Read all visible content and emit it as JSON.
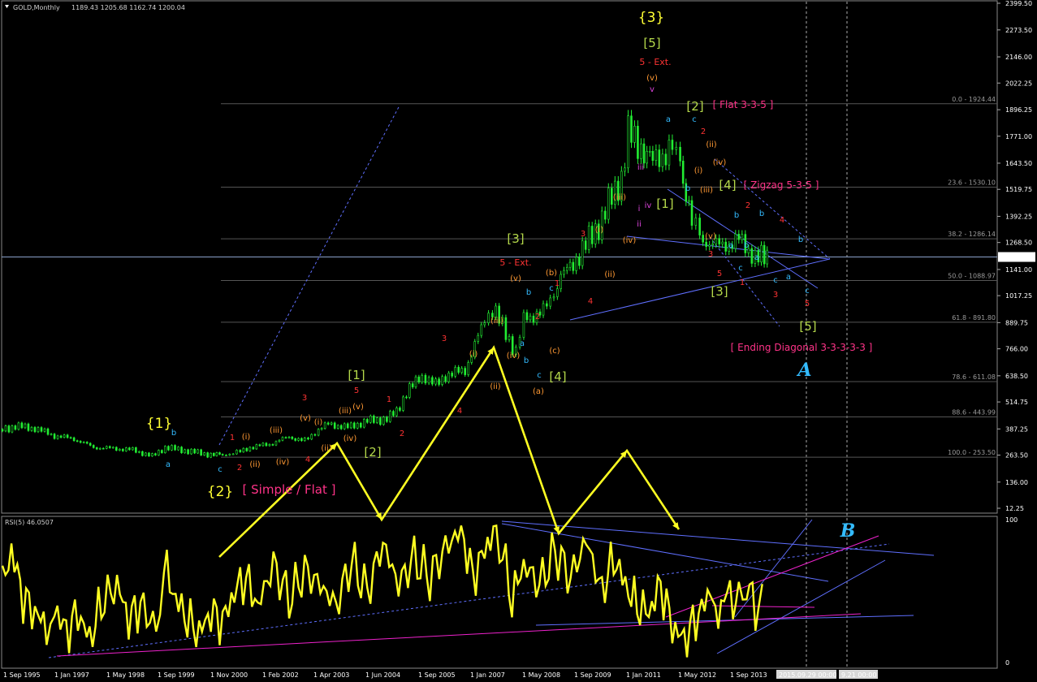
{
  "colors": {
    "background": "#000000",
    "price_candles": "#22ee33",
    "rsi_line": "#ffff22",
    "grid": "#2a2a2a",
    "fib_lines": "#555555",
    "trend_lines": "#5f6fff",
    "zigzag": "#ffff22",
    "magenta_lines": "#ee22cc",
    "wave_yellow": "#ffff33",
    "wave_green": "#b4d84a",
    "wave_red": "#ff3333",
    "wave_orange": "#ff9933",
    "wave_cyan": "#33bbff",
    "wave_violet": "#dd44dd",
    "label_pink": "#ff3388",
    "current_price_bg": "#000000"
  },
  "header": {
    "symbol_label": "GOLD,Monthly",
    "ohlc": "1189.43 1205.68 1162.74 1200.04"
  },
  "rsi_header": "RSI(5) 46.0507",
  "current_price": "1200.04",
  "chart_data": {
    "type": "candlestick",
    "series": [
      {
        "name": "GOLD,Monthly",
        "pane": "price"
      },
      {
        "name": "RSI(5)",
        "pane": "indicator"
      }
    ],
    "price_axis_ticks": [
      "2399.50",
      "2273.50",
      "2146.00",
      "2022.25",
      "1896.25",
      "1771.00",
      "1643.50",
      "1519.75",
      "1392.25",
      "1268.50",
      "1141.00",
      "1017.25",
      "889.75",
      "766.00",
      "638.50",
      "514.75",
      "387.25",
      "263.50",
      "136.00",
      "12.25"
    ],
    "rsi_axis_ticks": [
      "100",
      "0"
    ],
    "date_ticks": [
      "1 Sep 1995",
      "1 Jan 1997",
      "1 May 1998",
      "1 Sep 1999",
      "1 Nov 2000",
      "1 Feb 2002",
      "1 Apr 2003",
      "1 Jun 2004",
      "1 Sep 2005",
      "1 Jan 2007",
      "1 May 2008",
      "1 Sep 2009",
      "1 Jan 2011",
      "1 May 2012",
      "1 Sep 2013",
      "2015.09.29 00:00",
      "9.21 00:00"
    ],
    "fib_levels": [
      {
        "label": "0.0 - 1924.44",
        "value": 1924.44
      },
      {
        "label": "23.6 - 1530.10",
        "value": 1530.1
      },
      {
        "label": "38.2 - 1286.14",
        "value": 1286.14
      },
      {
        "label": "50.0 - 1088.97",
        "value": 1088.97
      },
      {
        "label": "61.8 - 891.80",
        "value": 891.8
      },
      {
        "label": "78.6 - 611.08",
        "value": 611.08
      },
      {
        "label": "88.6 - 443.99",
        "value": 443.99
      },
      {
        "label": "100.0 - 253.50",
        "value": 253.5
      }
    ],
    "price_series": [
      [
        1995.67,
        385
      ],
      [
        1996.0,
        400
      ],
      [
        1996.5,
        390
      ],
      [
        1997.0,
        355
      ],
      [
        1997.5,
        340
      ],
      [
        1998.0,
        300
      ],
      [
        1998.5,
        295
      ],
      [
        1999.0,
        288
      ],
      [
        1999.5,
        258
      ],
      [
        1999.83,
        300
      ],
      [
        2000.0,
        295
      ],
      [
        2000.5,
        280
      ],
      [
        2001.0,
        265
      ],
      [
        2001.3,
        265
      ],
      [
        2001.75,
        280
      ],
      [
        2002.0,
        300
      ],
      [
        2002.5,
        315
      ],
      [
        2003.0,
        350
      ],
      [
        2003.4,
        330
      ],
      [
        2003.75,
        385
      ],
      [
        2004.0,
        410
      ],
      [
        2004.5,
        395
      ],
      [
        2005.0,
        425
      ],
      [
        2005.5,
        435
      ],
      [
        2005.75,
        470
      ],
      [
        2006.0,
        560
      ],
      [
        2006.4,
        640
      ],
      [
        2006.75,
        595
      ],
      [
        2007.0,
        640
      ],
      [
        2007.5,
        665
      ],
      [
        2008.0,
        900
      ],
      [
        2008.2,
        960
      ],
      [
        2008.8,
        750
      ],
      [
        2009.0,
        910
      ],
      [
        2009.5,
        940
      ],
      [
        2009.95,
        1100
      ],
      [
        2010.5,
        1230
      ],
      [
        2011.0,
        1380
      ],
      [
        2011.5,
        1580
      ],
      [
        2011.67,
        1780
      ],
      [
        2012.0,
        1720
      ],
      [
        2012.3,
        1650
      ],
      [
        2012.8,
        1720
      ],
      [
        2013.0,
        1640
      ],
      [
        2013.3,
        1380
      ],
      [
        2013.5,
        1290
      ],
      [
        2014.0,
        1250
      ],
      [
        2014.5,
        1280
      ],
      [
        2015.0,
        1190
      ],
      [
        2015.3,
        1200
      ]
    ],
    "rsi_series": [
      [
        1995.67,
        55
      ],
      [
        1995.9,
        80
      ],
      [
        1996.2,
        45
      ],
      [
        1996.5,
        35
      ],
      [
        1996.8,
        25
      ],
      [
        1997.0,
        40
      ],
      [
        1997.3,
        20
      ],
      [
        1997.6,
        35
      ],
      [
        1997.9,
        15
      ],
      [
        1998.2,
        42
      ],
      [
        1998.6,
        55
      ],
      [
        1998.9,
        30
      ],
      [
        1999.2,
        40
      ],
      [
        1999.6,
        25
      ],
      [
        1999.8,
        70
      ],
      [
        2000.1,
        45
      ],
      [
        2000.4,
        30
      ],
      [
        2000.7,
        20
      ],
      [
        2001.0,
        35
      ],
      [
        2001.3,
        28
      ],
      [
        2001.6,
        50
      ],
      [
        2001.9,
        60
      ],
      [
        2002.2,
        40
      ],
      [
        2002.6,
        70
      ],
      [
        2003.0,
        45
      ],
      [
        2003.4,
        65
      ],
      [
        2003.8,
        55
      ],
      [
        2004.2,
        40
      ],
      [
        2004.6,
        72
      ],
      [
        2005.0,
        50
      ],
      [
        2005.4,
        85
      ],
      [
        2005.8,
        55
      ],
      [
        2006.2,
        75
      ],
      [
        2006.6,
        60
      ],
      [
        2007.0,
        82
      ],
      [
        2007.4,
        95
      ],
      [
        2007.7,
        60
      ],
      [
        2008.0,
        80
      ],
      [
        2008.3,
        98
      ],
      [
        2008.7,
        45
      ],
      [
        2009.0,
        70
      ],
      [
        2009.4,
        55
      ],
      [
        2009.8,
        80
      ],
      [
        2010.2,
        60
      ],
      [
        2010.6,
        88
      ],
      [
        2011.0,
        50
      ],
      [
        2011.3,
        75
      ],
      [
        2011.6,
        55
      ],
      [
        2011.9,
        40
      ],
      [
        2012.2,
        35
      ],
      [
        2012.5,
        55
      ],
      [
        2012.8,
        25
      ],
      [
        2013.1,
        15
      ],
      [
        2013.4,
        30
      ],
      [
        2013.7,
        45
      ],
      [
        2013.9,
        30
      ],
      [
        2014.2,
        50
      ],
      [
        2014.5,
        40
      ],
      [
        2014.7,
        55
      ],
      [
        2015.0,
        35
      ],
      [
        2015.2,
        40
      ]
    ],
    "ylim_price": [
      12.25,
      2399.5
    ],
    "ylim_rsi": [
      0,
      100
    ],
    "grid": true,
    "wave_labels": [
      {
        "text": "{1}",
        "color": "wave_yellow"
      },
      {
        "text": "{2}",
        "color": "wave_yellow"
      },
      {
        "text": "[ Simple / Flat ]",
        "color": "label_pink"
      },
      {
        "text": "[1]",
        "color": "wave_green"
      },
      {
        "text": "[2]",
        "color": "wave_green"
      },
      {
        "text": "[3]",
        "color": "wave_green"
      },
      {
        "text": "5 - Ext.",
        "color": "wave_red"
      },
      {
        "text": "[4]",
        "color": "wave_green"
      },
      {
        "text": "{3}",
        "color": "wave_yellow"
      },
      {
        "text": "[5]",
        "color": "wave_green"
      },
      {
        "text": "5 - Ext.",
        "color": "wave_red"
      },
      {
        "text": "[2]",
        "color": "wave_green"
      },
      {
        "text": "[ Flat 3-3-5 ]",
        "color": "label_pink"
      },
      {
        "text": "[4]",
        "color": "wave_green"
      },
      {
        "text": "[ Zigzag 5-3-5 ]",
        "color": "label_pink"
      },
      {
        "text": "[1]",
        "color": "wave_green"
      },
      {
        "text": "[3]",
        "color": "wave_green"
      },
      {
        "text": "[5]",
        "color": "wave_green"
      },
      {
        "text": "[ Ending Diagonal 3-3-3-3-3 ]",
        "color": "label_pink"
      },
      {
        "text": "A",
        "color": "wave_cyan"
      },
      {
        "text": "B",
        "color": "wave_cyan"
      }
    ],
    "small_labels": [
      {
        "text": "a",
        "color": "wave_cyan"
      },
      {
        "text": "b",
        "color": "wave_cyan"
      },
      {
        "text": "c",
        "color": "wave_cyan"
      },
      {
        "text": "1",
        "color": "wave_red"
      },
      {
        "text": "2",
        "color": "wave_red"
      },
      {
        "text": "3",
        "color": "wave_red"
      },
      {
        "text": "4",
        "color": "wave_red"
      },
      {
        "text": "5",
        "color": "wave_red"
      },
      {
        "text": "(i)",
        "color": "wave_orange"
      },
      {
        "text": "(ii)",
        "color": "wave_orange"
      },
      {
        "text": "(iii)",
        "color": "wave_orange"
      },
      {
        "text": "(iv)",
        "color": "wave_orange"
      },
      {
        "text": "(v)",
        "color": "wave_orange"
      },
      {
        "text": "(a)",
        "color": "wave_orange"
      },
      {
        "text": "(b)",
        "color": "wave_orange"
      },
      {
        "text": "(c)",
        "color": "wave_orange"
      },
      {
        "text": "i",
        "color": "wave_violet"
      },
      {
        "text": "ii",
        "color": "wave_violet"
      },
      {
        "text": "iii",
        "color": "wave_violet"
      },
      {
        "text": "iv",
        "color": "wave_violet"
      },
      {
        "text": "v",
        "color": "wave_violet"
      }
    ]
  }
}
